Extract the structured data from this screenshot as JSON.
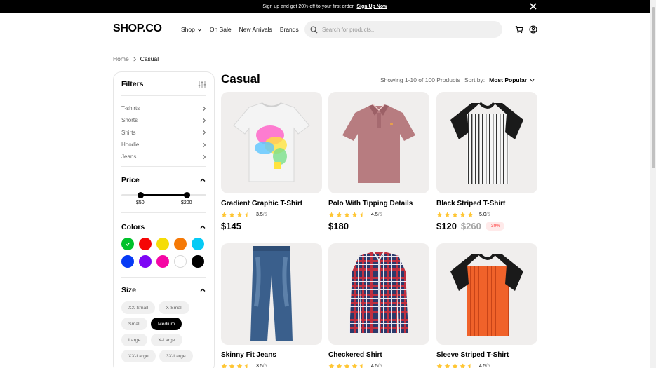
{
  "banner": {
    "text": "Sign up and get 20% off to your first order.",
    "link": "Sign Up Now"
  },
  "header": {
    "logo": "SHOP.CO",
    "nav": [
      "Shop",
      "On Sale",
      "New Arrivals",
      "Brands"
    ],
    "search_placeholder": "Search for products..."
  },
  "breadcrumb": {
    "home": "Home",
    "current": "Casual"
  },
  "filters": {
    "title": "Filters",
    "categories": [
      "T-shirts",
      "Shorts",
      "Shirts",
      "Hoodie",
      "Jeans"
    ],
    "price": {
      "title": "Price",
      "min_label": "$50",
      "max_label": "$200"
    },
    "colors": {
      "title": "Colors",
      "swatches": [
        "#00c12b",
        "#f50606",
        "#f5dd06",
        "#f57906",
        "#06caf5",
        "#063af5",
        "#7d06f5",
        "#f506a4",
        "#ffffff",
        "#000000"
      ],
      "selected_index": 0
    },
    "size": {
      "title": "Size",
      "rows": [
        [
          "XX-Small",
          "X-Small"
        ],
        [
          "Small",
          "Medium"
        ],
        [
          "Large",
          "X-Large"
        ],
        [
          "XX-Large",
          "3X-Large"
        ]
      ],
      "selected": "Medium"
    }
  },
  "main": {
    "title": "Casual",
    "showing": "Showing 1-10 of 100 Products",
    "sort_label": "Sort by:",
    "sort_value": "Most Popular"
  },
  "products": [
    {
      "name": "Gradient Graphic T-Shirt",
      "rating": 3.5,
      "rating_text": "3.5",
      "denominator": "/5",
      "price": "$145",
      "old_price": "",
      "discount": "",
      "image": "gradient-tshirt"
    },
    {
      "name": "Polo With Tipping Details",
      "rating": 4.5,
      "rating_text": "4.5",
      "denominator": "/5",
      "price": "$180",
      "old_price": "",
      "discount": "",
      "image": "polo"
    },
    {
      "name": "Black Striped T-Shirt",
      "rating": 5.0,
      "rating_text": "5.0",
      "denominator": "/5",
      "price": "$120",
      "old_price": "$260",
      "discount": "-30%",
      "image": "striped-tshirt"
    },
    {
      "name": "Skinny Fit Jeans",
      "rating": 3.5,
      "rating_text": "3.5",
      "denominator": "/5",
      "image": "jeans"
    },
    {
      "name": "Checkered Shirt",
      "rating": 4.5,
      "rating_text": "4.5",
      "denominator": "/5",
      "image": "checkered-shirt"
    },
    {
      "name": "Sleeve Striped T-Shirt",
      "rating": 4.5,
      "rating_text": "4.5",
      "denominator": "/5",
      "image": "orange-tshirt"
    }
  ],
  "colors": {
    "star": "#ffc633",
    "discount_text": "#ff3333",
    "discount_bg": "#ffeaea",
    "card_bg": "#f0eeed"
  }
}
